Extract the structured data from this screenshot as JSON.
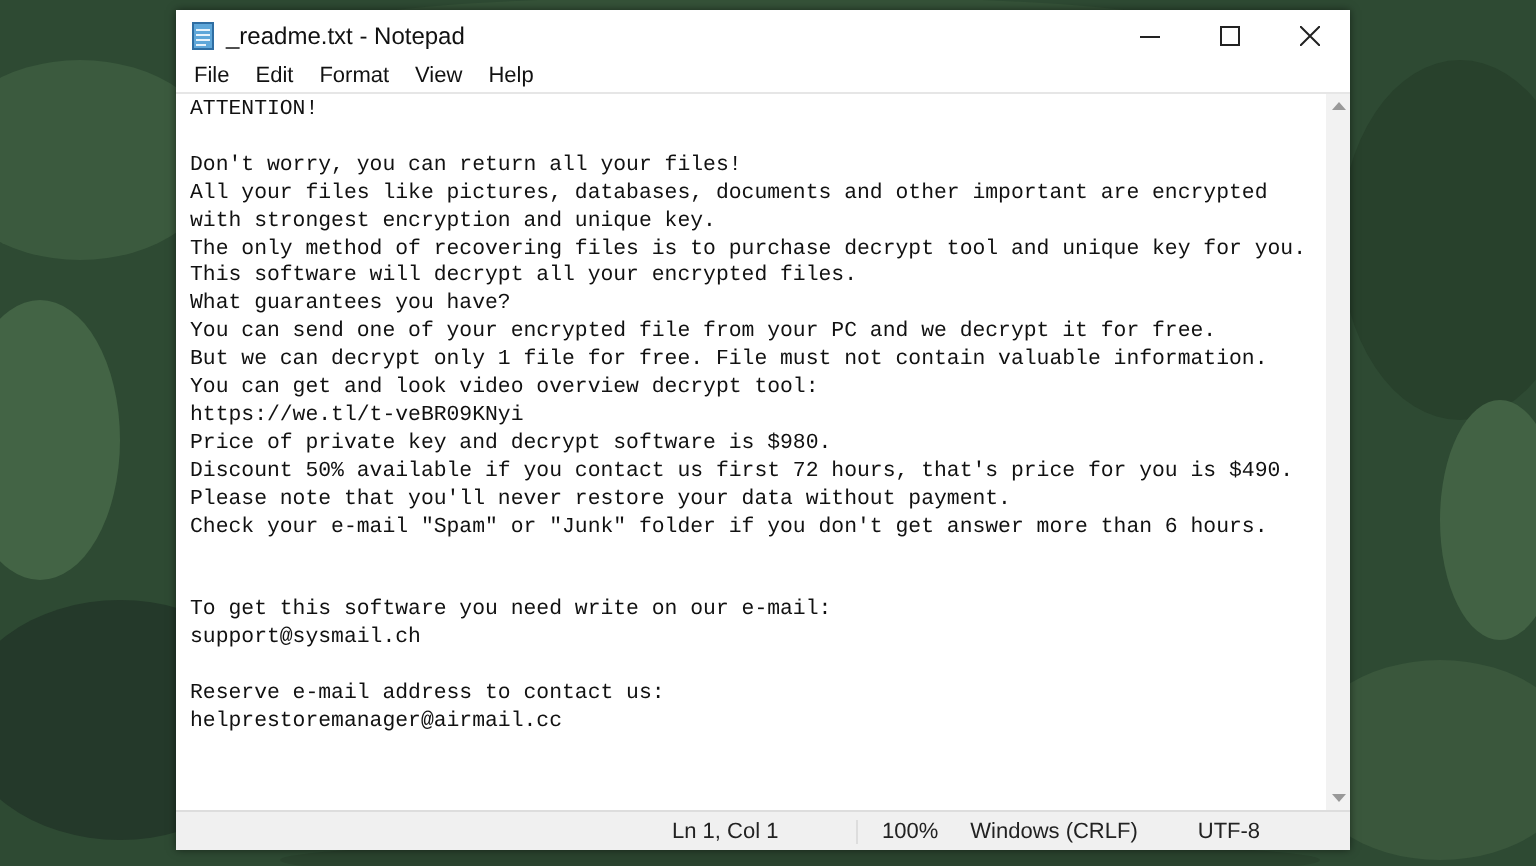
{
  "window": {
    "title": "_readme.txt - Notepad"
  },
  "menu": [
    "File",
    "Edit",
    "Format",
    "View",
    "Help"
  ],
  "document": [
    {
      "kind": "text",
      "text": "ATTENTION!"
    },
    {
      "kind": "blank"
    },
    {
      "kind": "text",
      "text": "Don't worry, you can return all your files!"
    },
    {
      "kind": "text",
      "text": "All your files like pictures, databases, documents and other important are encrypted"
    },
    {
      "kind": "text",
      "text": "with strongest encryption and unique key."
    },
    {
      "kind": "text",
      "text": "The only method of recovering files is to purchase decrypt tool and unique key for you."
    },
    {
      "kind": "text",
      "text": "This software will decrypt all your encrypted files."
    },
    {
      "kind": "text",
      "text": "What guarantees you have?"
    },
    {
      "kind": "text",
      "text": "You can send one of your encrypted file from your PC and we decrypt it for free."
    },
    {
      "kind": "text",
      "text": "But we can decrypt only 1 file for free. File must not contain valuable information."
    },
    {
      "kind": "text",
      "text": "You can get and look video overview decrypt tool:"
    },
    {
      "kind": "text",
      "text": "https://we.tl/t-veBR09KNyi"
    },
    {
      "kind": "text",
      "text": "Price of private key and decrypt software is $980."
    },
    {
      "kind": "text",
      "text": "Discount 50% available if you contact us first 72 hours, that's price for you is $490."
    },
    {
      "kind": "text",
      "text": "Please note that you'll never restore your data without payment."
    },
    {
      "kind": "text",
      "text": "Check your e-mail \"Spam\" or \"Junk\" folder if you don't get answer more than 6 hours."
    },
    {
      "kind": "blank"
    },
    {
      "kind": "blank"
    },
    {
      "kind": "text",
      "text": "To get this software you need write on our e-mail:"
    },
    {
      "kind": "text",
      "text": "support@sysmail.ch"
    },
    {
      "kind": "blank"
    },
    {
      "kind": "text",
      "text": "Reserve e-mail address to contact us:"
    },
    {
      "kind": "text",
      "text": "helprestoremanager@airmail.cc"
    }
  ],
  "status_bar": {
    "position": "Ln 1, Col 1",
    "zoom": "100%",
    "line_endings": "Windows (CRLF)",
    "encoding": "UTF-8"
  }
}
